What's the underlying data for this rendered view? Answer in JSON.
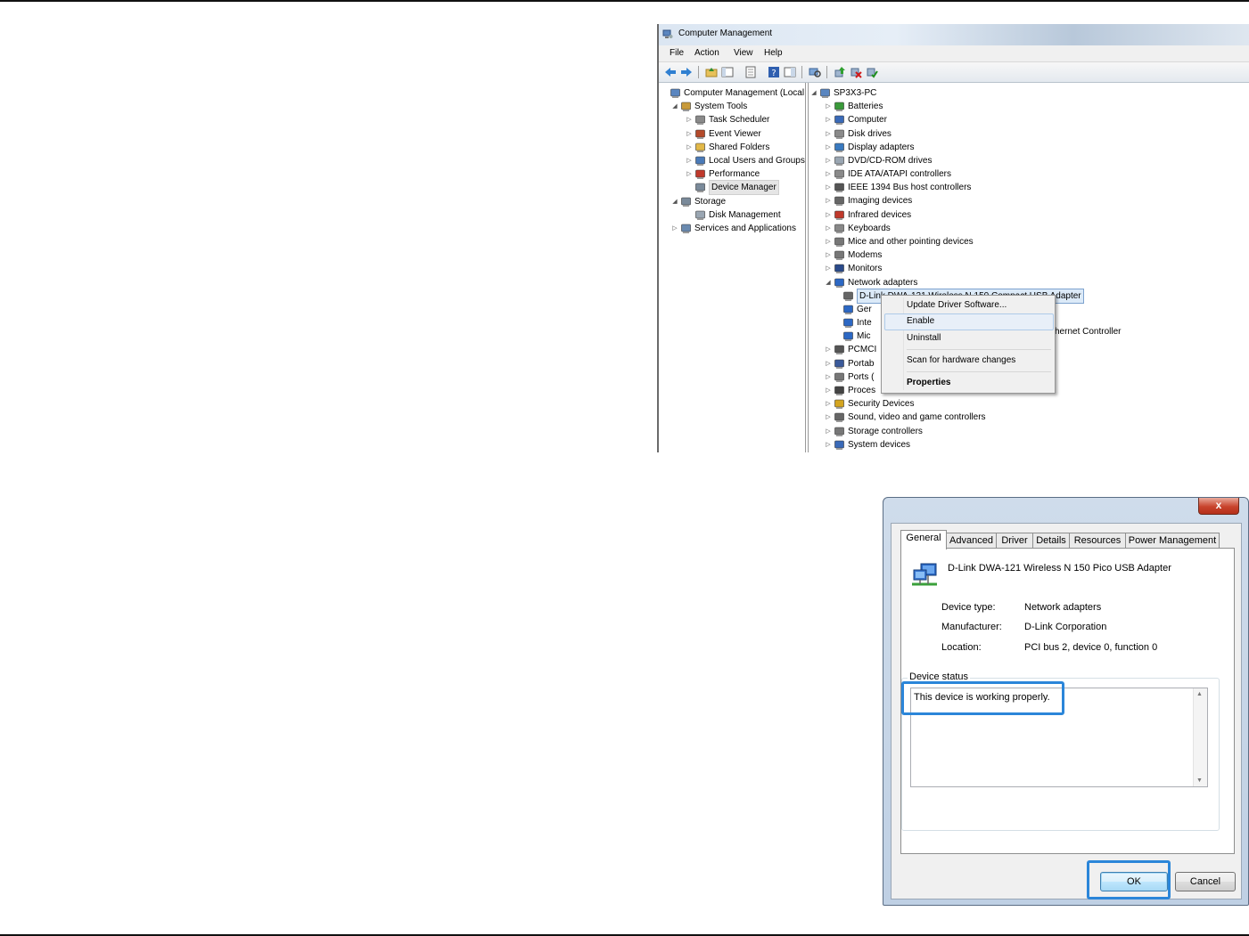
{
  "computer_management": {
    "title": "Computer Management",
    "menu": [
      "File",
      "Action",
      "View",
      "Help"
    ],
    "toolbar_icons": [
      "back-icon",
      "forward-icon",
      "up-folder-icon",
      "console-tree-icon",
      "export-icon",
      "help-icon",
      "action-pane-icon",
      "scan-icon",
      "update-driver-icon",
      "disable-icon",
      "enable-icon"
    ],
    "left_tree": [
      {
        "label": "Computer Management (Local",
        "arrow": "",
        "icon": "computer-management-icon"
      },
      {
        "label": "System Tools",
        "arrow": "◢",
        "icon": "tools-icon"
      },
      {
        "label": "Task Scheduler",
        "arrow": "▷",
        "icon": "clock-icon"
      },
      {
        "label": "Event Viewer",
        "arrow": "▷",
        "icon": "event-viewer-icon"
      },
      {
        "label": "Shared Folders",
        "arrow": "▷",
        "icon": "shared-folder-icon"
      },
      {
        "label": "Local Users and Groups",
        "arrow": "▷",
        "icon": "users-icon"
      },
      {
        "label": "Performance",
        "arrow": "▷",
        "icon": "performance-icon"
      },
      {
        "label": "Device Manager",
        "arrow": "",
        "icon": "device-manager-icon"
      },
      {
        "label": "Storage",
        "arrow": "◢",
        "icon": "storage-icon"
      },
      {
        "label": "Disk Management",
        "arrow": "",
        "icon": "disk-management-icon"
      },
      {
        "label": "Services and Applications",
        "arrow": "▷",
        "icon": "services-icon"
      }
    ],
    "right_tree": [
      {
        "label": "SP3X3-PC",
        "arrow": "◢",
        "icon": "pc-icon"
      },
      {
        "label": "Batteries",
        "arrow": "▷",
        "icon": "battery-icon"
      },
      {
        "label": "Computer",
        "arrow": "▷",
        "icon": "computer-icon"
      },
      {
        "label": "Disk drives",
        "arrow": "▷",
        "icon": "disk-drive-icon"
      },
      {
        "label": "Display adapters",
        "arrow": "▷",
        "icon": "display-adapter-icon"
      },
      {
        "label": "DVD/CD-ROM drives",
        "arrow": "▷",
        "icon": "dvd-icon"
      },
      {
        "label": "IDE ATA/ATAPI controllers",
        "arrow": "▷",
        "icon": "ide-icon"
      },
      {
        "label": "IEEE 1394 Bus host controllers",
        "arrow": "▷",
        "icon": "ieee1394-icon"
      },
      {
        "label": "Imaging devices",
        "arrow": "▷",
        "icon": "camera-icon"
      },
      {
        "label": "Infrared devices",
        "arrow": "▷",
        "icon": "infrared-icon"
      },
      {
        "label": "Keyboards",
        "arrow": "▷",
        "icon": "keyboard-icon"
      },
      {
        "label": "Mice and other pointing devices",
        "arrow": "▷",
        "icon": "mouse-icon"
      },
      {
        "label": "Modems",
        "arrow": "▷",
        "icon": "modem-icon"
      },
      {
        "label": "Monitors",
        "arrow": "▷",
        "icon": "monitor-icon"
      },
      {
        "label": "Network adapters",
        "arrow": "◢",
        "icon": "network-adapter-icon"
      },
      {
        "label": "D-Link DWA-121 Wireless N 150 Compact USB Adapter",
        "arrow": "",
        "icon": "disabled-network-icon"
      },
      {
        "label": "Ger",
        "arrow": "",
        "icon": "network-adapter-icon"
      },
      {
        "label": "Inte",
        "arrow": "",
        "icon": "network-adapter-icon"
      },
      {
        "label": "Mic",
        "arrow": "",
        "icon": "network-adapter-icon"
      },
      {
        "label": "PCMCI",
        "arrow": "▷",
        "icon": "pcmcia-icon"
      },
      {
        "label": "Portab",
        "arrow": "▷",
        "icon": "portable-device-icon"
      },
      {
        "label": "Ports (",
        "arrow": "▷",
        "icon": "port-icon"
      },
      {
        "label": "Proces",
        "arrow": "▷",
        "icon": "processor-icon"
      },
      {
        "label": "Security Devices",
        "arrow": "▷",
        "icon": "security-key-icon"
      },
      {
        "label": "Sound, video and game controllers",
        "arrow": "▷",
        "icon": "speaker-icon"
      },
      {
        "label": "Storage controllers",
        "arrow": "▷",
        "icon": "storage-controller-icon"
      },
      {
        "label": "System devices",
        "arrow": "▷",
        "icon": "system-device-icon"
      }
    ],
    "behind_menu_text": "hernet Controller"
  },
  "context_menu": {
    "items": [
      "Update Driver Software...",
      "Enable",
      "Uninstall",
      "Scan for hardware changes",
      "Properties"
    ]
  },
  "properties_dialog": {
    "close_label": "x",
    "tabs": [
      "General",
      "Advanced",
      "Driver",
      "Details",
      "Resources",
      "Power Management"
    ],
    "device_name": "D-Link DWA-121 Wireless N 150 Pico USB Adapter",
    "props": [
      {
        "label": "Device type:",
        "value": "Network adapters"
      },
      {
        "label": "Manufacturer:",
        "value": "D-Link Corporation"
      },
      {
        "label": "Location:",
        "value": "PCI bus 2, device 0, function 0"
      }
    ],
    "status_title": "Device status",
    "status_text": "This device is working properly.",
    "ok_label": "OK",
    "cancel_label": "Cancel",
    "highlight_color": "#2b86d9"
  }
}
